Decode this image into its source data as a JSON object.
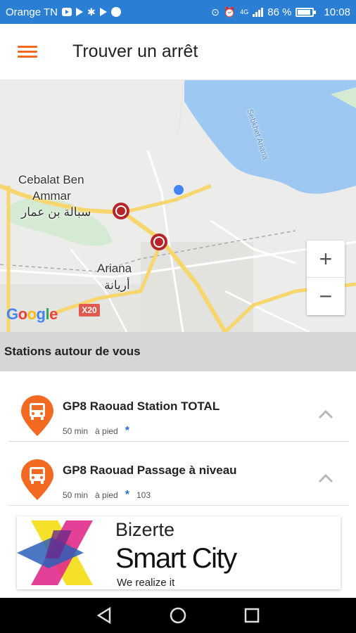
{
  "status_bar": {
    "carrier": "Orange TN",
    "network": "4G",
    "battery": "86 %",
    "time": "10:08",
    "icons": [
      "youtube-icon",
      "play-icon",
      "bluetooth-icon",
      "play-store-icon",
      "messenger-icon",
      "location-icon",
      "alarm-icon",
      "signal-icon",
      "battery-icon"
    ]
  },
  "header": {
    "title": "Trouver un arrêt",
    "menu_icon": "hamburger-menu-icon",
    "accent_color": "#f26a21"
  },
  "map": {
    "labels": {
      "cebalat_line1": "Cebalat Ben",
      "cebalat_line2": "Ammar",
      "cebalat_arabic": "سبالة بن عمار",
      "ariana": "Ariana",
      "ariana_arabic": "أريانة",
      "sebkhet": "Sebkhet Ariana",
      "road": "X20"
    },
    "zoom_in": "+",
    "zoom_out": "−",
    "attribution": [
      "G",
      "o",
      "o",
      "g",
      "l",
      "e"
    ],
    "water_color": "#9dc8f2",
    "road_color": "#f8d66e"
  },
  "section": {
    "title": "Stations autour de vous"
  },
  "stations": [
    {
      "name": "GP8 Raouad Station TOTAL",
      "time": "50 min",
      "mode": "à pied",
      "star": "*",
      "route": ""
    },
    {
      "name": "GP8 Raouad Passage à niveau",
      "time": "50 min",
      "mode": "à pied",
      "star": "*",
      "route": "103"
    }
  ],
  "banner": {
    "line1": "Bizerte",
    "line2": "Smart City",
    "line3": "We realize it"
  },
  "nav": {
    "back": "back-icon",
    "home": "home-icon",
    "recents": "recents-icon"
  }
}
